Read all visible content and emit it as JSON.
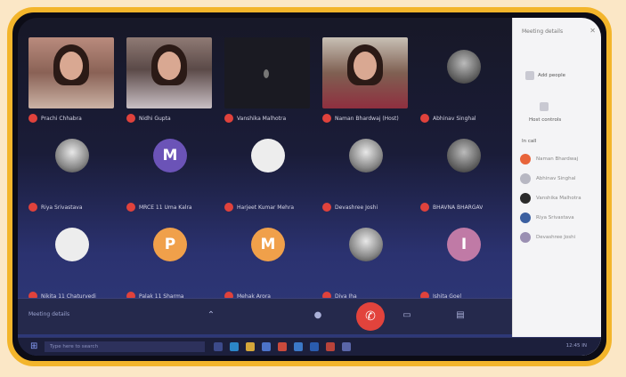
{
  "participants": [
    {
      "name": "Prachi Chhabra",
      "type": "video",
      "style": "girl1"
    },
    {
      "name": "Nidhi Gupta",
      "type": "video",
      "style": "girl2"
    },
    {
      "name": "Vanshika Malhotra",
      "type": "video",
      "style": "dark"
    },
    {
      "name": "Naman Bhardwaj (Host)",
      "type": "video",
      "style": "boy"
    },
    {
      "name": "Abhinav Singhal",
      "type": "avatar",
      "style": "dim",
      "letter": ""
    },
    {
      "name": "Riya Srivastava",
      "type": "avatar",
      "style": "photo",
      "letter": ""
    },
    {
      "name": "MRCE 11 Uma Kalra",
      "type": "avatar",
      "style": "letter",
      "letter": "M"
    },
    {
      "name": "Harjeet Kumar Mehra",
      "type": "avatar",
      "style": "white",
      "letter": ""
    },
    {
      "name": "Devashree Joshi",
      "type": "avatar",
      "style": "photo",
      "letter": ""
    },
    {
      "name": "BHAVNA BHARGAV",
      "type": "avatar",
      "style": "dim",
      "letter": ""
    },
    {
      "name": "Nikita 11 Chaturvedi",
      "type": "avatar",
      "style": "white",
      "letter": ""
    },
    {
      "name": "Palak 11 Sharma",
      "type": "avatar",
      "style": "orange",
      "letter": "P"
    },
    {
      "name": "Mehak Arora",
      "type": "avatar",
      "style": "orange",
      "letter": "M"
    },
    {
      "name": "Diya Jha",
      "type": "avatar",
      "style": "photo",
      "letter": ""
    },
    {
      "name": "Ishita Goel",
      "type": "avatar",
      "style": "pink",
      "letter": "I"
    }
  ],
  "panel": {
    "title": "Meeting details",
    "close": "✕",
    "add_people": "Add people",
    "host_controls": "Host controls",
    "section": "In call",
    "people": [
      {
        "name": "Naman Bhardwaj",
        "color": "#e8643a"
      },
      {
        "name": "Abhinav Singhal",
        "color": "#b7b7c2"
      },
      {
        "name": "Vanshika Malhotra",
        "color": "#2a2a2a"
      },
      {
        "name": "Riya Srivastava",
        "color": "#3b5fa0"
      },
      {
        "name": "Devashree Joshi",
        "color": "#9a8fb2"
      }
    ]
  },
  "controls": {
    "meeting_code": "Meeting details",
    "end_call": "✆"
  },
  "taskbar": {
    "search": "Type here to search",
    "tray": "12:45  IN"
  },
  "colors": {
    "frame": "#f3b52b",
    "background": "#fbe7c6",
    "mic_muted": "#e0423c"
  }
}
